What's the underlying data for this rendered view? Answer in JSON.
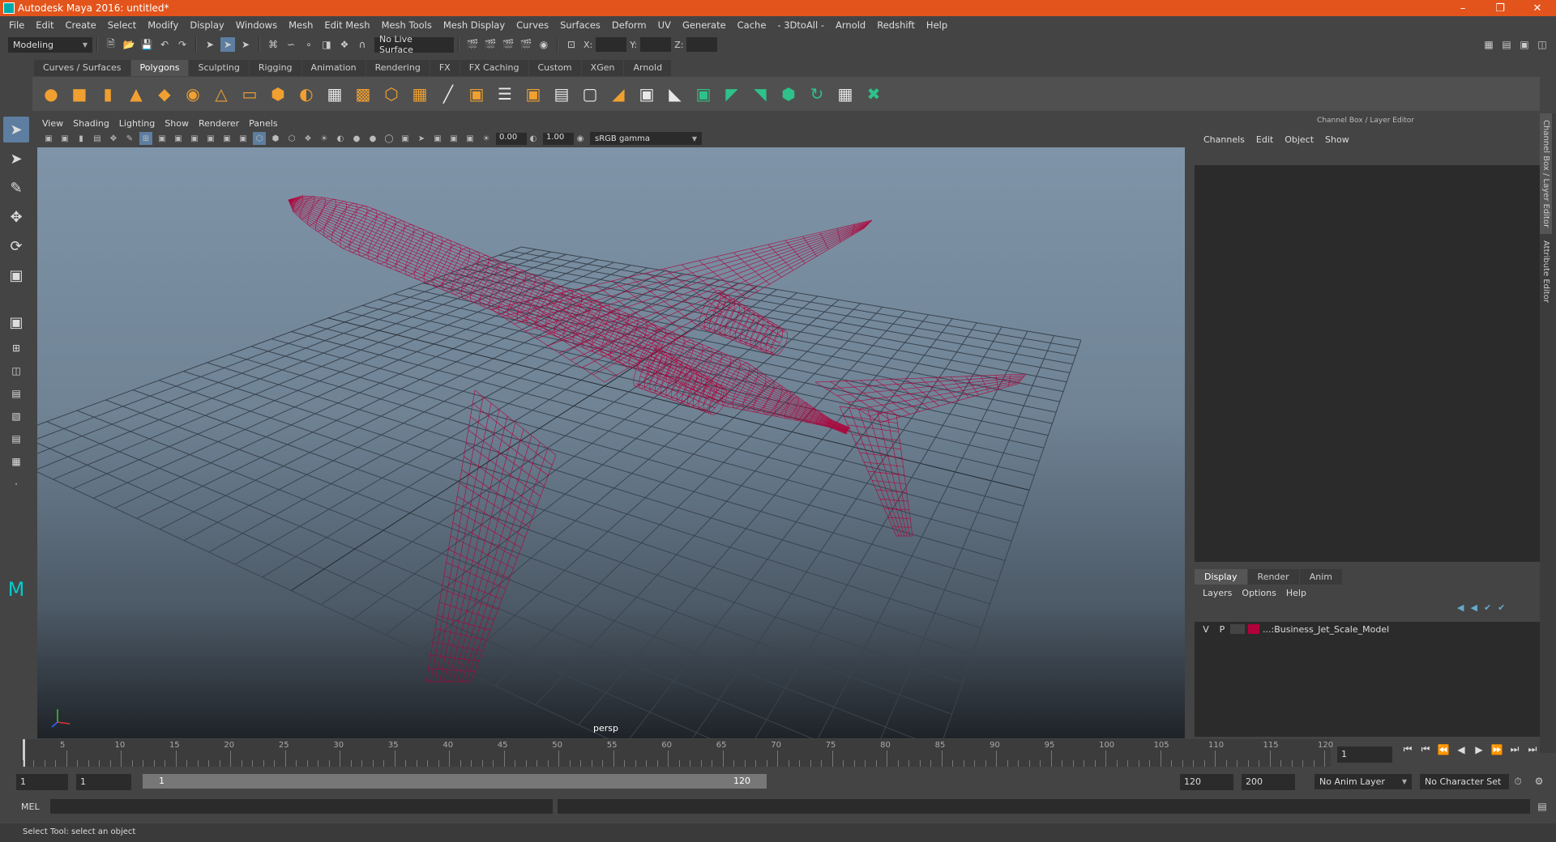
{
  "title": "Autodesk Maya 2016: untitled*",
  "menu": [
    "File",
    "Edit",
    "Create",
    "Select",
    "Modify",
    "Display",
    "Windows",
    "Mesh",
    "Edit Mesh",
    "Mesh Tools",
    "Mesh Display",
    "Curves",
    "Surfaces",
    "Deform",
    "UV",
    "Generate",
    "Cache",
    "- 3DtoAll -",
    "Arnold",
    "Redshift",
    "Help"
  ],
  "status": {
    "mode": "Modeling",
    "live_surface": "No Live Surface",
    "x_label": "X:",
    "y_label": "Y:",
    "z_label": "Z:"
  },
  "shelf_tabs": [
    "Curves / Surfaces",
    "Polygons",
    "Sculpting",
    "Rigging",
    "Animation",
    "Rendering",
    "FX",
    "FX Caching",
    "Custom",
    "XGen",
    "Arnold"
  ],
  "shelf_active": "Polygons",
  "viewport": {
    "menu": [
      "View",
      "Shading",
      "Lighting",
      "Show",
      "Renderer",
      "Panels"
    ],
    "field1": "0.00",
    "field2": "1.00",
    "color_space": "sRGB gamma",
    "camera": "persp",
    "wire_color": "#b0003a"
  },
  "right_panel": {
    "title": "Channel Box / Layer Editor",
    "channel_menu": [
      "Channels",
      "Edit",
      "Object",
      "Show"
    ],
    "layer_tabs": [
      "Display",
      "Render",
      "Anim"
    ],
    "layer_menu": [
      "Layers",
      "Options",
      "Help"
    ],
    "layer": {
      "v": "V",
      "p": "P",
      "name": "...:Business_Jet_Scale_Model",
      "color": "#b2003a"
    },
    "side_tabs": [
      "Channel Box / Layer Editor",
      "Attribute Editor"
    ]
  },
  "timeline": {
    "labels": [
      "5",
      "10",
      "15",
      "20",
      "25",
      "30",
      "35",
      "40",
      "45",
      "50",
      "55",
      "60",
      "65",
      "70",
      "75",
      "80",
      "85",
      "90",
      "95",
      "100",
      "105",
      "110",
      "115",
      "120"
    ],
    "current_frame": "1"
  },
  "range": {
    "start": "1",
    "playback_start": "1",
    "bar_start": "1",
    "bar_end": "120",
    "playback_end": "120",
    "end": "200",
    "anim_layer": "No Anim Layer",
    "char_set": "No Character Set"
  },
  "command": {
    "label": "MEL"
  },
  "help_line": "Select Tool: select an object"
}
